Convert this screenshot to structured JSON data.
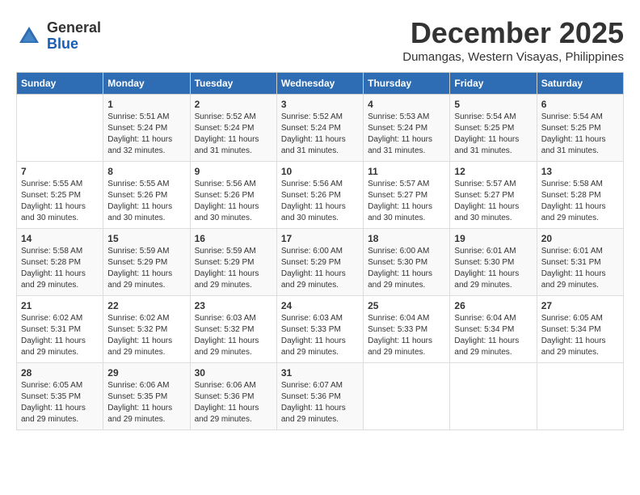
{
  "header": {
    "logo_general": "General",
    "logo_blue": "Blue",
    "month": "December 2025",
    "location": "Dumangas, Western Visayas, Philippines"
  },
  "days_of_week": [
    "Sunday",
    "Monday",
    "Tuesday",
    "Wednesday",
    "Thursday",
    "Friday",
    "Saturday"
  ],
  "weeks": [
    [
      {
        "day": "",
        "info": ""
      },
      {
        "day": "1",
        "info": "Sunrise: 5:51 AM\nSunset: 5:24 PM\nDaylight: 11 hours and 32 minutes."
      },
      {
        "day": "2",
        "info": "Sunrise: 5:52 AM\nSunset: 5:24 PM\nDaylight: 11 hours and 31 minutes."
      },
      {
        "day": "3",
        "info": "Sunrise: 5:52 AM\nSunset: 5:24 PM\nDaylight: 11 hours and 31 minutes."
      },
      {
        "day": "4",
        "info": "Sunrise: 5:53 AM\nSunset: 5:24 PM\nDaylight: 11 hours and 31 minutes."
      },
      {
        "day": "5",
        "info": "Sunrise: 5:54 AM\nSunset: 5:25 PM\nDaylight: 11 hours and 31 minutes."
      },
      {
        "day": "6",
        "info": "Sunrise: 5:54 AM\nSunset: 5:25 PM\nDaylight: 11 hours and 31 minutes."
      }
    ],
    [
      {
        "day": "7",
        "info": "Sunrise: 5:55 AM\nSunset: 5:25 PM\nDaylight: 11 hours and 30 minutes."
      },
      {
        "day": "8",
        "info": "Sunrise: 5:55 AM\nSunset: 5:26 PM\nDaylight: 11 hours and 30 minutes."
      },
      {
        "day": "9",
        "info": "Sunrise: 5:56 AM\nSunset: 5:26 PM\nDaylight: 11 hours and 30 minutes."
      },
      {
        "day": "10",
        "info": "Sunrise: 5:56 AM\nSunset: 5:26 PM\nDaylight: 11 hours and 30 minutes."
      },
      {
        "day": "11",
        "info": "Sunrise: 5:57 AM\nSunset: 5:27 PM\nDaylight: 11 hours and 30 minutes."
      },
      {
        "day": "12",
        "info": "Sunrise: 5:57 AM\nSunset: 5:27 PM\nDaylight: 11 hours and 30 minutes."
      },
      {
        "day": "13",
        "info": "Sunrise: 5:58 AM\nSunset: 5:28 PM\nDaylight: 11 hours and 29 minutes."
      }
    ],
    [
      {
        "day": "14",
        "info": "Sunrise: 5:58 AM\nSunset: 5:28 PM\nDaylight: 11 hours and 29 minutes."
      },
      {
        "day": "15",
        "info": "Sunrise: 5:59 AM\nSunset: 5:29 PM\nDaylight: 11 hours and 29 minutes."
      },
      {
        "day": "16",
        "info": "Sunrise: 5:59 AM\nSunset: 5:29 PM\nDaylight: 11 hours and 29 minutes."
      },
      {
        "day": "17",
        "info": "Sunrise: 6:00 AM\nSunset: 5:29 PM\nDaylight: 11 hours and 29 minutes."
      },
      {
        "day": "18",
        "info": "Sunrise: 6:00 AM\nSunset: 5:30 PM\nDaylight: 11 hours and 29 minutes."
      },
      {
        "day": "19",
        "info": "Sunrise: 6:01 AM\nSunset: 5:30 PM\nDaylight: 11 hours and 29 minutes."
      },
      {
        "day": "20",
        "info": "Sunrise: 6:01 AM\nSunset: 5:31 PM\nDaylight: 11 hours and 29 minutes."
      }
    ],
    [
      {
        "day": "21",
        "info": "Sunrise: 6:02 AM\nSunset: 5:31 PM\nDaylight: 11 hours and 29 minutes."
      },
      {
        "day": "22",
        "info": "Sunrise: 6:02 AM\nSunset: 5:32 PM\nDaylight: 11 hours and 29 minutes."
      },
      {
        "day": "23",
        "info": "Sunrise: 6:03 AM\nSunset: 5:32 PM\nDaylight: 11 hours and 29 minutes."
      },
      {
        "day": "24",
        "info": "Sunrise: 6:03 AM\nSunset: 5:33 PM\nDaylight: 11 hours and 29 minutes."
      },
      {
        "day": "25",
        "info": "Sunrise: 6:04 AM\nSunset: 5:33 PM\nDaylight: 11 hours and 29 minutes."
      },
      {
        "day": "26",
        "info": "Sunrise: 6:04 AM\nSunset: 5:34 PM\nDaylight: 11 hours and 29 minutes."
      },
      {
        "day": "27",
        "info": "Sunrise: 6:05 AM\nSunset: 5:34 PM\nDaylight: 11 hours and 29 minutes."
      }
    ],
    [
      {
        "day": "28",
        "info": "Sunrise: 6:05 AM\nSunset: 5:35 PM\nDaylight: 11 hours and 29 minutes."
      },
      {
        "day": "29",
        "info": "Sunrise: 6:06 AM\nSunset: 5:35 PM\nDaylight: 11 hours and 29 minutes."
      },
      {
        "day": "30",
        "info": "Sunrise: 6:06 AM\nSunset: 5:36 PM\nDaylight: 11 hours and 29 minutes."
      },
      {
        "day": "31",
        "info": "Sunrise: 6:07 AM\nSunset: 5:36 PM\nDaylight: 11 hours and 29 minutes."
      },
      {
        "day": "",
        "info": ""
      },
      {
        "day": "",
        "info": ""
      },
      {
        "day": "",
        "info": ""
      }
    ]
  ]
}
